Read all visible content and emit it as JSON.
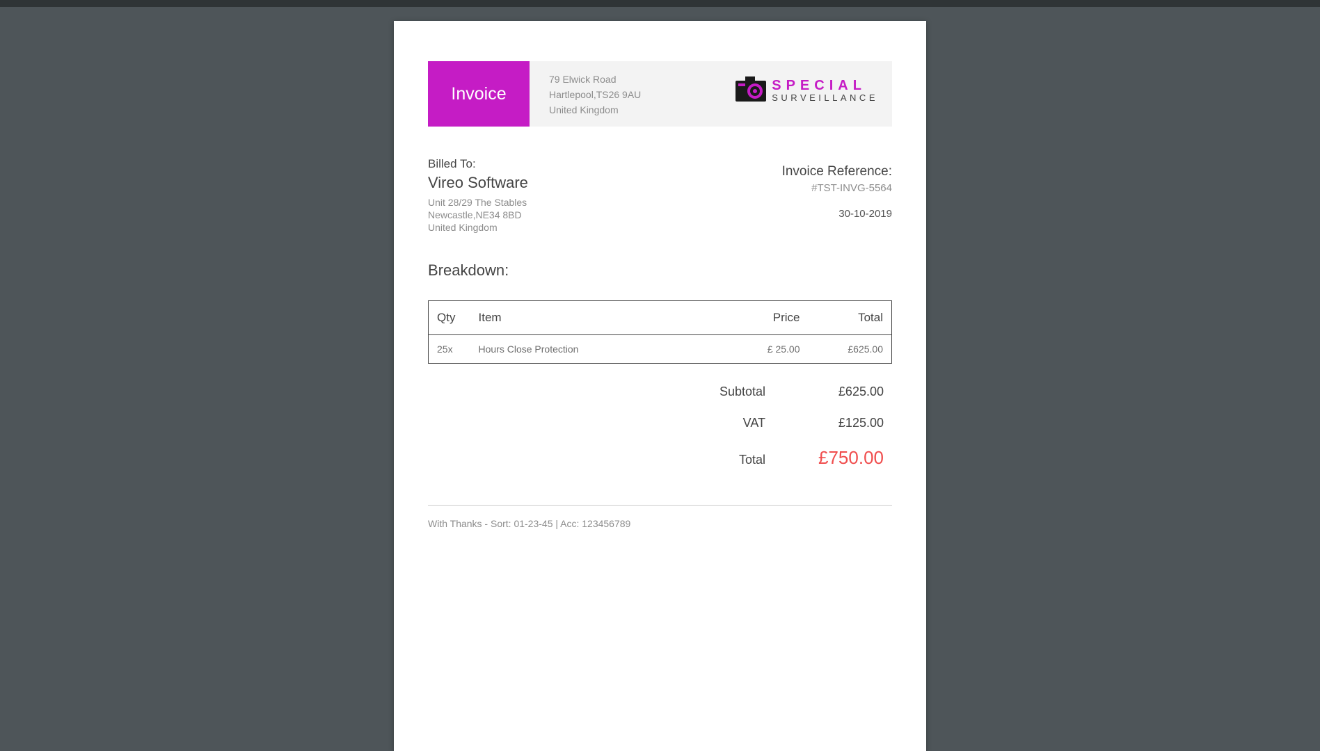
{
  "header": {
    "badge": "Invoice",
    "address": {
      "line1": "79 Elwick Road",
      "line2": "Hartlepool,TS26 9AU",
      "line3": "United Kingdom"
    },
    "brand": {
      "line1": "SPECIAL",
      "line2": "SURVEILLANCE"
    }
  },
  "billed_to": {
    "label": "Billed To:",
    "name": "Vireo Software",
    "address": {
      "line1": "Unit 28/29 The Stables",
      "line2": "Newcastle,NE34 8BD",
      "line3": "United Kingdom"
    }
  },
  "invoice": {
    "label": "Invoice Reference:",
    "reference": "#TST-INVG-5564",
    "date": "30-10-2019"
  },
  "breakdown": {
    "title": "Breakdown:",
    "headers": {
      "qty": "Qty",
      "item": "Item",
      "price": "Price",
      "total": "Total"
    },
    "rows": [
      {
        "qty": "25x",
        "item": "Hours Close Protection",
        "price": "£ 25.00",
        "total": "£625.00"
      }
    ]
  },
  "totals": {
    "subtotal": {
      "label": "Subtotal",
      "value": "£625.00"
    },
    "vat": {
      "label": "VAT",
      "value": "£125.00"
    },
    "total": {
      "label": "Total",
      "value": "£750.00"
    }
  },
  "footer": "With Thanks - Sort: 01-23-45 | Acc: 123456789"
}
